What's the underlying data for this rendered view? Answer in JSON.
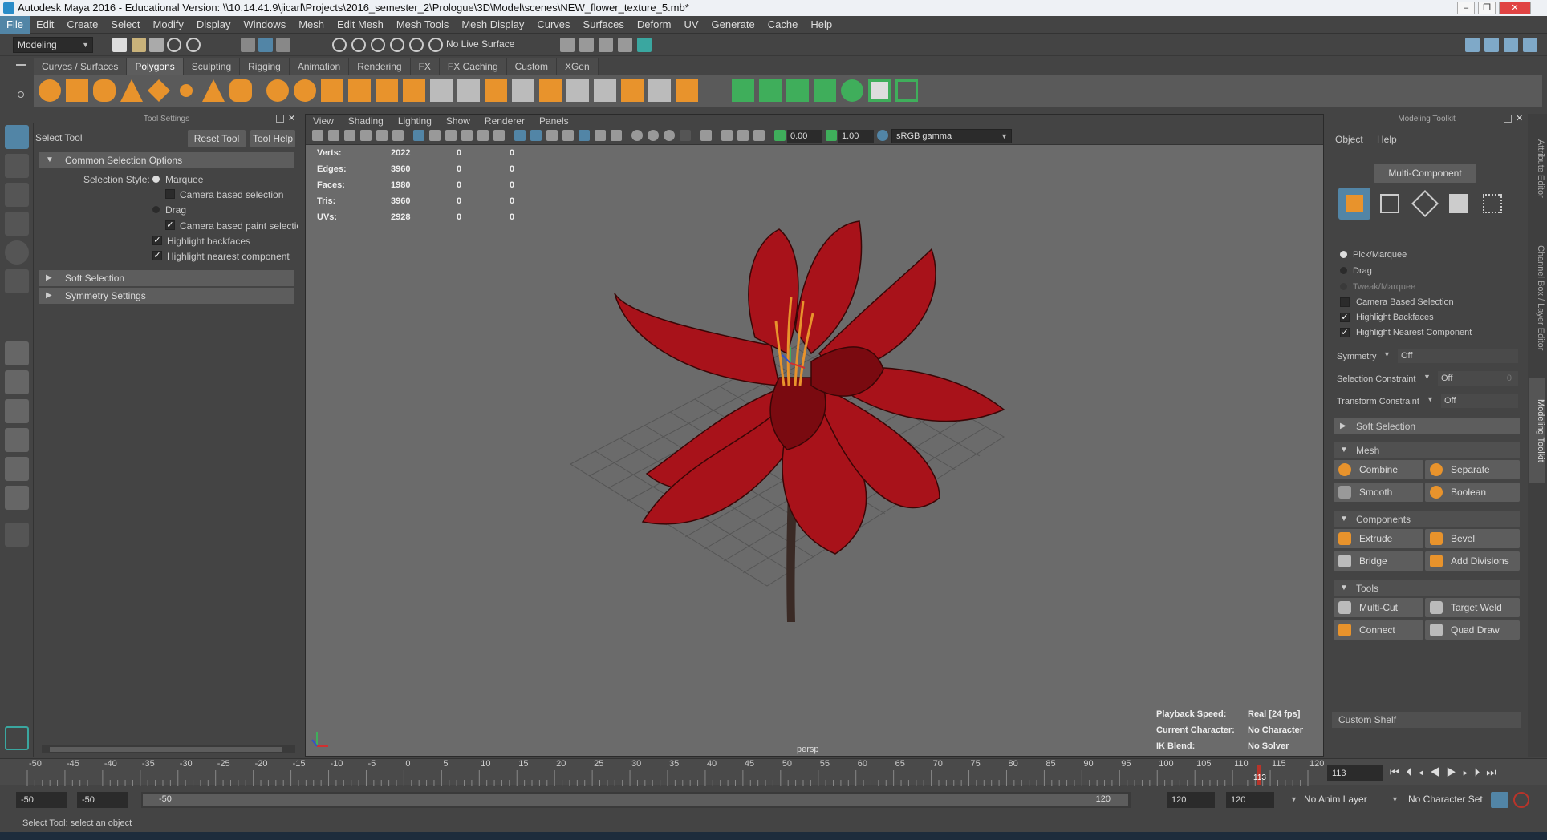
{
  "window": {
    "title": "Autodesk Maya 2016 - Educational Version: \\\\10.14.41.9\\jicarl\\Projects\\2016_semester_2\\Prologue\\3D\\Model\\scenes\\NEW_flower_texture_5.mb*"
  },
  "menu": [
    "File",
    "Edit",
    "Create",
    "Select",
    "Modify",
    "Display",
    "Windows",
    "Mesh",
    "Edit Mesh",
    "Mesh Tools",
    "Mesh Display",
    "Curves",
    "Surfaces",
    "Deform",
    "UV",
    "Generate",
    "Cache",
    "Help"
  ],
  "status": {
    "mode": "Modeling",
    "live_surface": "No Live Surface"
  },
  "shelf_tabs": [
    "Curves / Surfaces",
    "Polygons",
    "Sculpting",
    "Rigging",
    "Animation",
    "Rendering",
    "FX",
    "FX Caching",
    "Custom",
    "XGen"
  ],
  "shelf_active": "Polygons",
  "tool_settings": {
    "panel_title": "Tool Settings",
    "tool_name": "Select Tool",
    "reset": "Reset Tool",
    "help": "Tool Help",
    "common_section": "Common Selection Options",
    "selection_style_label": "Selection Style:",
    "marquee": "Marquee",
    "camera_based": "Camera based selection",
    "drag": "Drag",
    "camera_paint": "Camera based paint selectio",
    "highlight_backfaces": "Highlight backfaces",
    "highlight_nearest": "Highlight nearest component",
    "soft_selection": "Soft Selection",
    "symmetry_settings": "Symmetry Settings"
  },
  "viewport": {
    "menu": [
      "View",
      "Shading",
      "Lighting",
      "Show",
      "Renderer",
      "Panels"
    ],
    "exposure": "0.00",
    "gamma": "1.00",
    "color_space": "sRGB gamma",
    "stats": [
      {
        "label": "Verts:",
        "a": "2022",
        "b": "0",
        "c": "0"
      },
      {
        "label": "Edges:",
        "a": "3960",
        "b": "0",
        "c": "0"
      },
      {
        "label": "Faces:",
        "a": "1980",
        "b": "0",
        "c": "0"
      },
      {
        "label": "Tris:",
        "a": "3960",
        "b": "0",
        "c": "0"
      },
      {
        "label": "UVs:",
        "a": "2928",
        "b": "0",
        "c": "0"
      }
    ],
    "camera": "persp",
    "hud": [
      {
        "label": "Playback Speed:",
        "value": "Real [24 fps]"
      },
      {
        "label": "Current Character:",
        "value": "No Character"
      },
      {
        "label": "IK Blend:",
        "value": "No Solver"
      }
    ]
  },
  "toolkit": {
    "title": "Modeling Toolkit",
    "menu_object": "Object",
    "menu_help": "Help",
    "multi_component": "Multi-Component",
    "pick": "Pick/Marquee",
    "drag": "Drag",
    "tweak": "Tweak/Marquee",
    "camera_based": "Camera Based Selection",
    "highlight_backfaces": "Highlight Backfaces",
    "highlight_nearest": "Highlight Nearest Component",
    "symmetry_label": "Symmetry",
    "symmetry_value": "Off",
    "sel_constraint_label": "Selection Constraint",
    "sel_constraint_value": "Off",
    "sel_constraint_num": "0",
    "xform_constraint_label": "Transform Constraint",
    "xform_constraint_value": "Off",
    "soft_selection": "Soft Selection",
    "mesh": "Mesh",
    "combine": "Combine",
    "separate": "Separate",
    "smooth": "Smooth",
    "boolean": "Boolean",
    "components": "Components",
    "extrude": "Extrude",
    "bevel": "Bevel",
    "bridge": "Bridge",
    "add_divisions": "Add Divisions",
    "tools": "Tools",
    "multi_cut": "Multi-Cut",
    "target_weld": "Target Weld",
    "connect": "Connect",
    "quad_draw": "Quad Draw",
    "custom_shelf": "Custom Shelf"
  },
  "side_tabs": [
    "Attribute Editor",
    "Channel Box / Layer Editor",
    "Modeling Toolkit"
  ],
  "timeline": {
    "ticks": [
      "-50",
      "-45",
      "-40",
      "-35",
      "-30",
      "-25",
      "-20",
      "-15",
      "-10",
      "-5",
      "0",
      "5",
      "10",
      "15",
      "20",
      "25",
      "30",
      "35",
      "40",
      "45",
      "50",
      "55",
      "60",
      "65",
      "70",
      "75",
      "80",
      "85",
      "90",
      "95",
      "100",
      "105",
      "110",
      "115",
      "120"
    ],
    "current_frame": "113",
    "current_marker": "113"
  },
  "range": {
    "start": "-50",
    "anim_start": "-50",
    "slider_left": "-50",
    "slider_right": "120",
    "anim_end": "120",
    "end": "120",
    "anim_layer": "No Anim Layer",
    "char_set": "No Character Set"
  },
  "help_line": "Select Tool: select an object",
  "colors": {
    "accent": "#5285a6",
    "mesh_orange": "#e8932c",
    "flower_red": "#a8121a",
    "stem": "#3a2a25",
    "timeline_marker": "#b8342a"
  }
}
